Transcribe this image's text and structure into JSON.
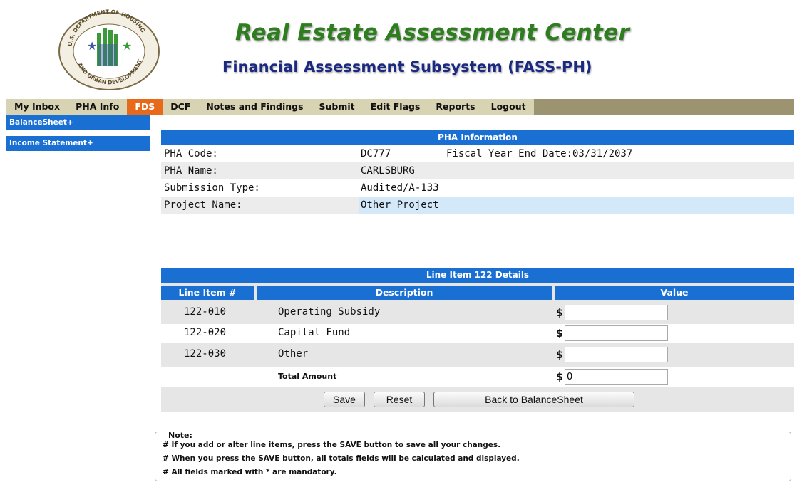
{
  "header": {
    "title": "Real Estate Assessment Center",
    "subtitle": "Financial Assessment Subsystem (FASS-PH)",
    "logo_text": "U.S. DEPARTMENT OF HOUSING AND URBAN DEVELOPMENT"
  },
  "nav": {
    "items": [
      "My Inbox",
      "PHA Info",
      "FDS",
      "DCF",
      "Notes and Findings",
      "Submit",
      "Edit Flags",
      "Reports",
      "Logout"
    ],
    "active": "FDS"
  },
  "sidebar": {
    "items": [
      "BalanceSheet+",
      "Income Statement+"
    ]
  },
  "pha_info": {
    "header": "PHA Information",
    "rows": [
      {
        "label": "PHA Code:",
        "value": "DC777",
        "extra": "Fiscal Year End Date:03/31/2037"
      },
      {
        "label": "PHA Name:",
        "value": "CARLSBURG"
      },
      {
        "label": "Submission Type:",
        "value": "Audited/A-133"
      },
      {
        "label": "Project Name:",
        "value": "Other Project"
      }
    ]
  },
  "line_items": {
    "header": "Line Item 122 Details",
    "columns": [
      "Line Item #",
      "Description",
      "Value"
    ],
    "rows": [
      {
        "code": "122-010",
        "description": "Operating Subsidy",
        "currency": "$",
        "value": ""
      },
      {
        "code": "122-020",
        "description": "Capital Fund",
        "currency": "$",
        "value": ""
      },
      {
        "code": "122-030",
        "description": "Other",
        "currency": "$",
        "value": ""
      }
    ],
    "total": {
      "label": "Total Amount",
      "currency": "$",
      "value": "0"
    },
    "buttons": {
      "save": "Save",
      "reset": "Reset",
      "back": "Back to BalanceSheet"
    }
  },
  "note": {
    "title": "Note:",
    "lines": [
      "# If you add or alter line items, press the SAVE button to save all your changes.",
      "# When you press the SAVE button, all totals fields will be calculated and displayed.",
      "# All fields marked with * are mandatory."
    ]
  },
  "colors": {
    "title_green": "#2e7d1e",
    "subtitle_navy": "#1b2a80",
    "nav_bg": "#d8d3b3",
    "nav_active": "#e8691a",
    "accent_blue": "#1a6fd3"
  }
}
